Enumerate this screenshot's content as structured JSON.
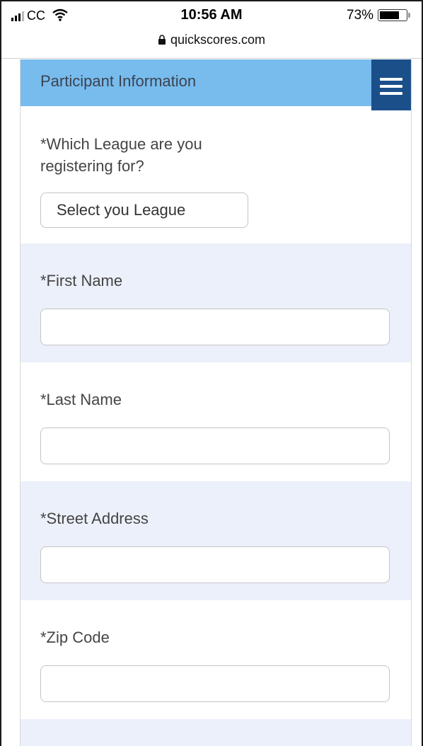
{
  "status_bar": {
    "carrier": "CC",
    "time": "10:56 AM",
    "battery_percent": "73%",
    "battery_level": 0.73
  },
  "browser": {
    "url": "quickscores.com"
  },
  "header": {
    "title": "Participant Information",
    "menu_icon": "hamburger-menu-icon"
  },
  "form": {
    "league": {
      "label_line1": "*Which League are you",
      "label_line2": "registering for?",
      "select_value": "Select you League"
    },
    "first_name": {
      "label": "*First Name",
      "value": ""
    },
    "last_name": {
      "label": "*Last Name",
      "value": ""
    },
    "street_address": {
      "label": "*Street Address",
      "value": ""
    },
    "zip_code": {
      "label": "*Zip Code",
      "value": ""
    }
  },
  "colors": {
    "header_bg": "#78bcee",
    "menu_bg": "#1b4f8a",
    "shaded_row": "#ecf0fa"
  }
}
